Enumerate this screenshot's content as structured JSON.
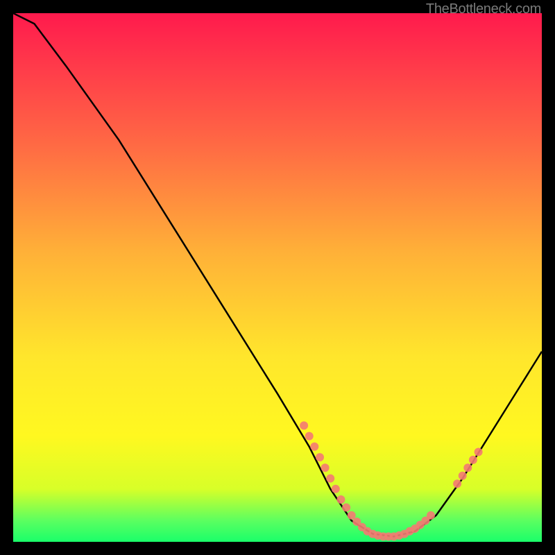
{
  "attribution": "TheBottleneck.com",
  "chart_data": {
    "type": "line",
    "title": "",
    "xlabel": "",
    "ylabel": "",
    "xlim": [
      0,
      100
    ],
    "ylim": [
      0,
      100
    ],
    "curve": [
      {
        "x": 0,
        "y": 100
      },
      {
        "x": 4,
        "y": 98
      },
      {
        "x": 10,
        "y": 90
      },
      {
        "x": 20,
        "y": 76
      },
      {
        "x": 30,
        "y": 60
      },
      {
        "x": 40,
        "y": 44
      },
      {
        "x": 50,
        "y": 28
      },
      {
        "x": 56,
        "y": 18
      },
      {
        "x": 60,
        "y": 10
      },
      {
        "x": 64,
        "y": 4
      },
      {
        "x": 68,
        "y": 1.5
      },
      {
        "x": 72,
        "y": 1
      },
      {
        "x": 76,
        "y": 2
      },
      {
        "x": 80,
        "y": 5
      },
      {
        "x": 85,
        "y": 12
      },
      {
        "x": 90,
        "y": 20
      },
      {
        "x": 95,
        "y": 28
      },
      {
        "x": 100,
        "y": 36
      }
    ],
    "dots": [
      {
        "x": 55,
        "y": 22
      },
      {
        "x": 56,
        "y": 20
      },
      {
        "x": 57,
        "y": 18
      },
      {
        "x": 58,
        "y": 16
      },
      {
        "x": 59,
        "y": 14
      },
      {
        "x": 60,
        "y": 12
      },
      {
        "x": 61,
        "y": 10
      },
      {
        "x": 62,
        "y": 8
      },
      {
        "x": 63,
        "y": 6.5
      },
      {
        "x": 64,
        "y": 5
      },
      {
        "x": 65,
        "y": 3.8
      },
      {
        "x": 66,
        "y": 2.8
      },
      {
        "x": 67,
        "y": 2
      },
      {
        "x": 68,
        "y": 1.5
      },
      {
        "x": 69,
        "y": 1.2
      },
      {
        "x": 70,
        "y": 1
      },
      {
        "x": 71,
        "y": 1
      },
      {
        "x": 72,
        "y": 1
      },
      {
        "x": 73,
        "y": 1.2
      },
      {
        "x": 74,
        "y": 1.5
      },
      {
        "x": 75,
        "y": 2
      },
      {
        "x": 76,
        "y": 2.5
      },
      {
        "x": 77,
        "y": 3.2
      },
      {
        "x": 78,
        "y": 4
      },
      {
        "x": 79,
        "y": 5
      },
      {
        "x": 84,
        "y": 11
      },
      {
        "x": 85,
        "y": 12.5
      },
      {
        "x": 86,
        "y": 14
      },
      {
        "x": 87,
        "y": 15.5
      },
      {
        "x": 88,
        "y": 17
      }
    ]
  }
}
